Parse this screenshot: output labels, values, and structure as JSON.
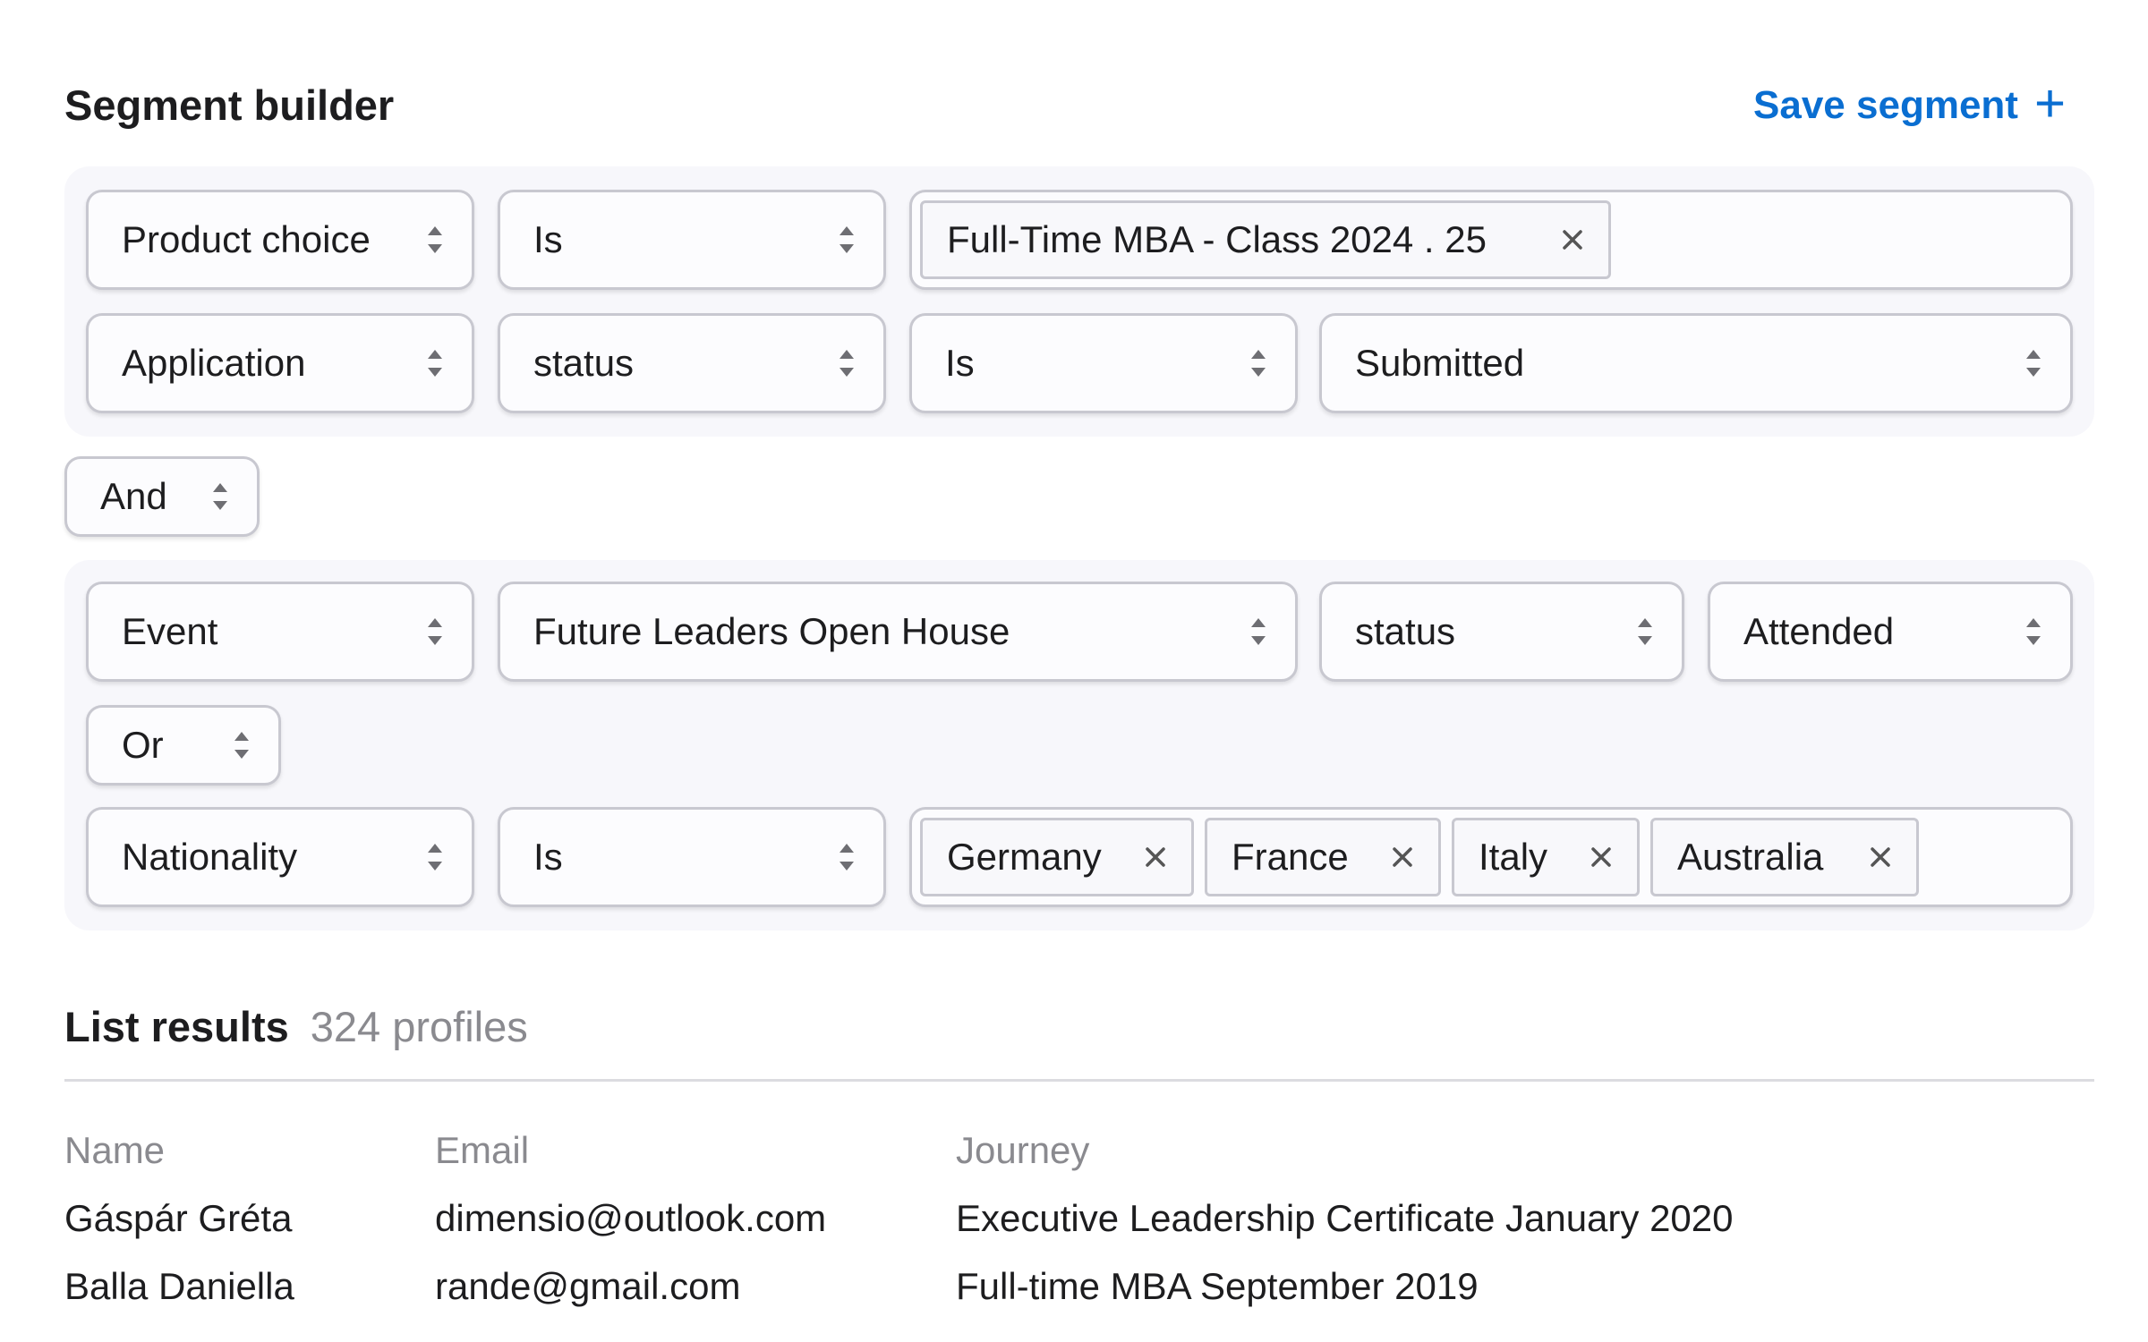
{
  "header": {
    "title": "Segment builder",
    "save_label": "Save segment",
    "save_icon": "+"
  },
  "group1": {
    "row1": {
      "field": "Product choice",
      "operator": "Is",
      "tags": [
        "Full-Time MBA - Class 2024 . 25"
      ]
    },
    "row2": {
      "field": "Application",
      "attribute": "status",
      "operator": "Is",
      "value": "Submitted"
    }
  },
  "connector": {
    "value": "And"
  },
  "group2": {
    "row1": {
      "field": "Event",
      "event_name": "Future Leaders Open House",
      "attribute": "status",
      "value": "Attended"
    },
    "connector": {
      "value": "Or"
    },
    "row2": {
      "field": "Nationality",
      "operator": "Is",
      "tags": [
        "Germany",
        "France",
        "Italy",
        "Australia"
      ]
    }
  },
  "results": {
    "title": "List results",
    "count": "324 profiles",
    "columns": [
      "Name",
      "Email",
      "Journey"
    ],
    "rows": [
      {
        "name": "Gáspár Gréta",
        "email": "dimensio@outlook.com",
        "journey": "Executive Leadership Certificate January 2020"
      },
      {
        "name": "Balla Daniella",
        "email": "rande@gmail.com",
        "journey": "Full-time MBA September 2019"
      }
    ]
  },
  "colors": {
    "accent": "#0a6ed1",
    "group_bg": "#f7f7fb",
    "border": "#c8c8d0",
    "muted_text": "#8a8a8f"
  },
  "icons": {
    "select_arrows": "sort-arrows-icon",
    "tag_remove": "close-icon",
    "save": "plus-icon"
  }
}
